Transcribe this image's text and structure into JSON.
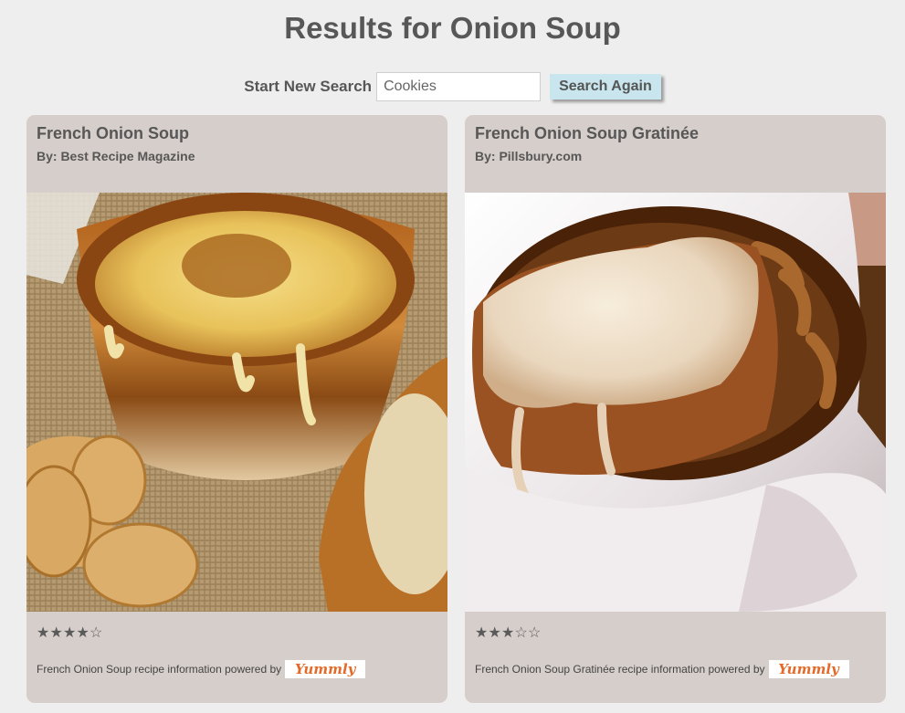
{
  "page": {
    "title": "Results for Onion Soup"
  },
  "search": {
    "label": "Start New Search",
    "value": "Cookies",
    "button_label": "Search Again"
  },
  "recipes": [
    {
      "title": "French Onion Soup",
      "author": "By: Best Recipe Magazine",
      "rating": 4,
      "rating_max": 5,
      "credit": "French Onion Soup recipe information powered by",
      "logo_text": "Yummly"
    },
    {
      "title": "French Onion Soup Gratinée",
      "author": "By: Pillsbury.com",
      "rating": 3,
      "rating_max": 5,
      "credit": "French Onion Soup Gratinée recipe information powered by",
      "logo_text": "Yummly"
    }
  ],
  "colors": {
    "background": "#efeeee",
    "card": "#d6ceca",
    "button": "#c9e6ee",
    "logo": "#e46a2a"
  }
}
